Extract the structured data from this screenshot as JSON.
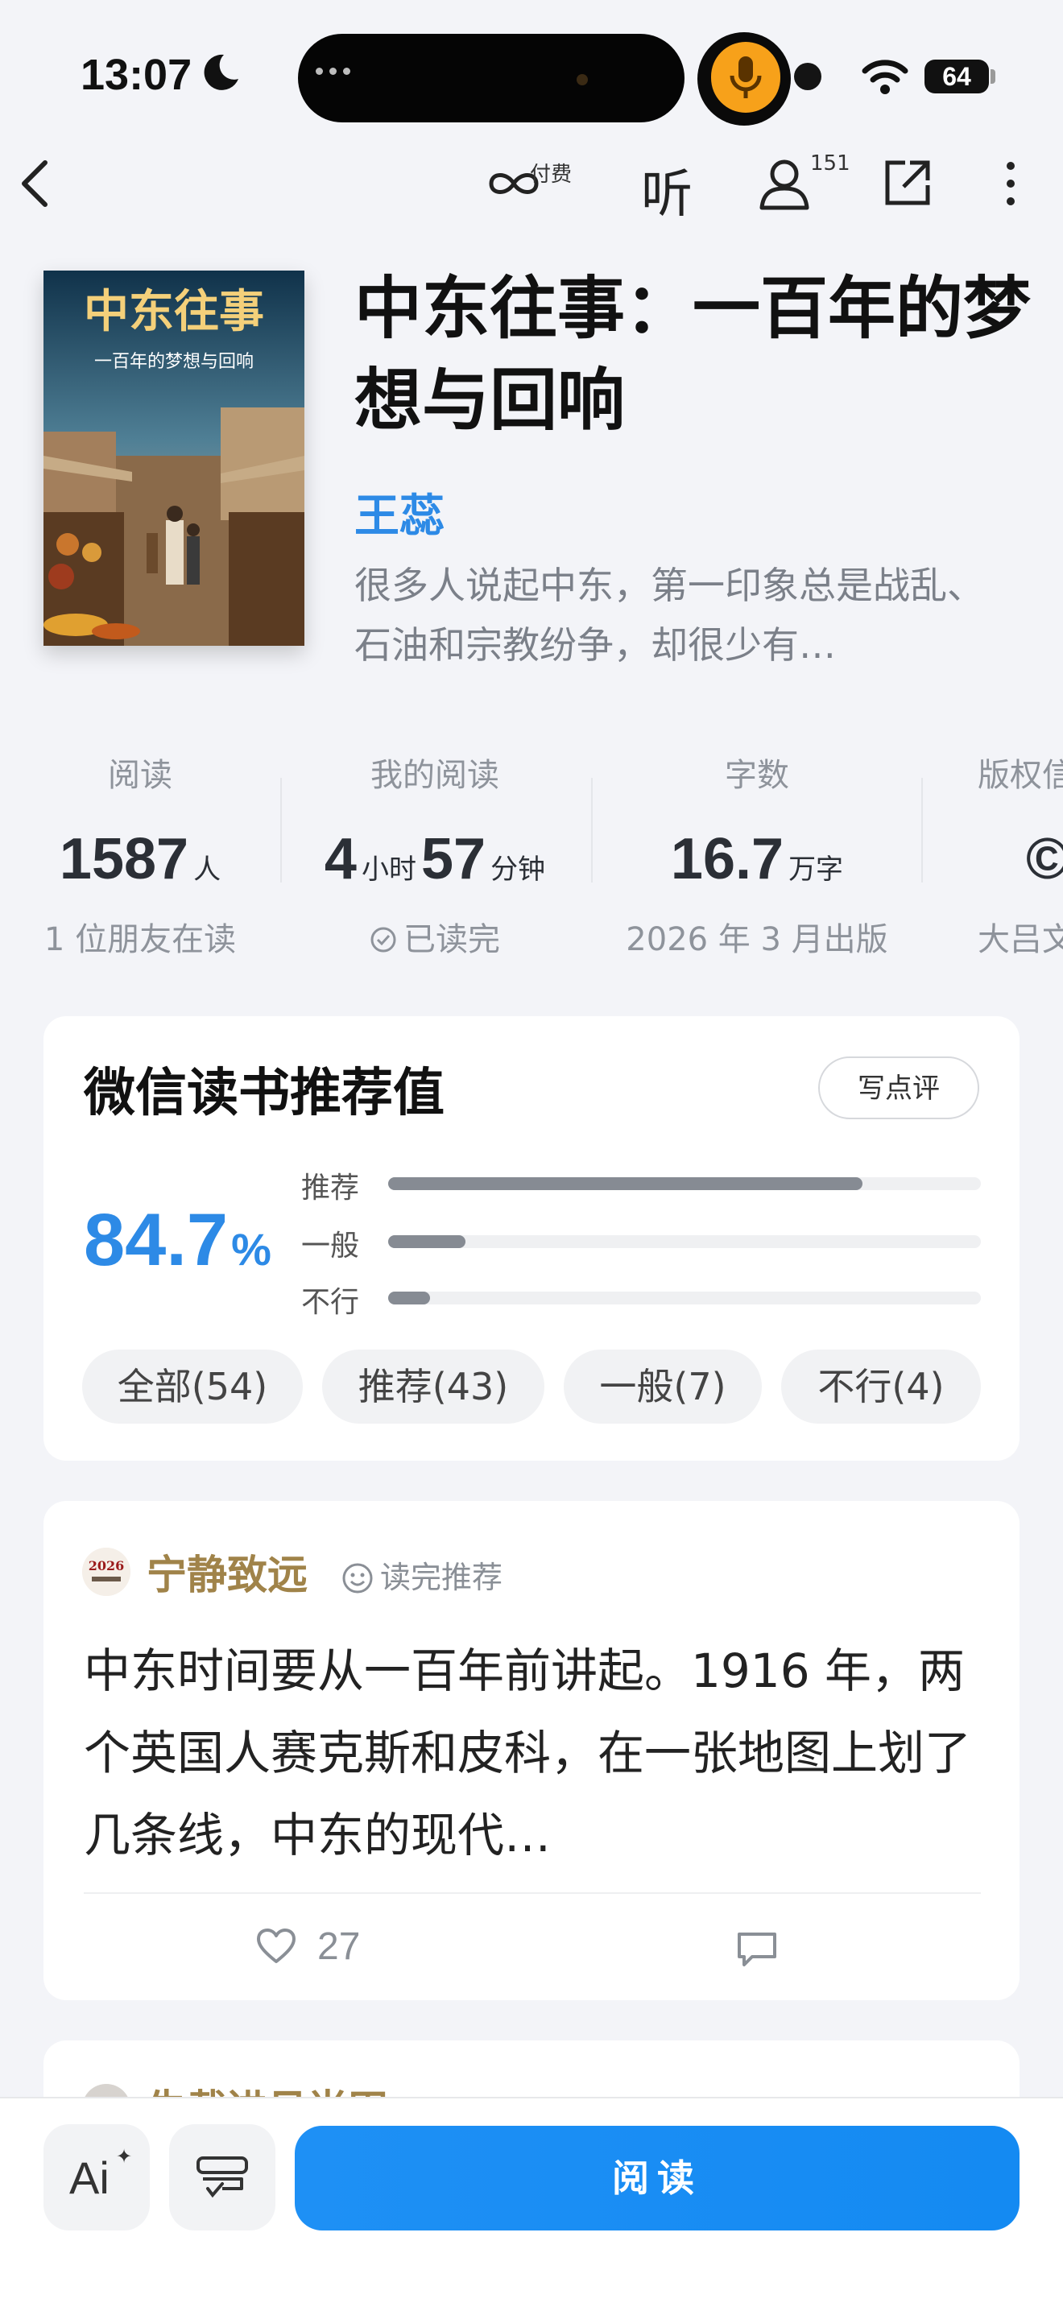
{
  "status_bar": {
    "time": "13:07",
    "battery": "64"
  },
  "nav": {
    "paid_label": "付费",
    "listen_label": "听",
    "readers_count": "151"
  },
  "book": {
    "cover_title": "中东往事",
    "cover_subtitle": "一百年的梦想与回响",
    "title": "中东往事：一百年的梦想与回响",
    "author": "王蕊",
    "description": "很多人说起中东，第一印象总是战乱、石油和宗教纷争，却很少有…"
  },
  "stats": [
    {
      "label": "阅读",
      "value": "1587",
      "unit": "人",
      "sub": "1 位朋友在读"
    },
    {
      "label": "我的阅读",
      "value_hours": "4",
      "unit_hours": "小时",
      "value_minutes": "57",
      "unit_minutes": "分钟",
      "sub": "已读完"
    },
    {
      "label": "字数",
      "value": "16.7",
      "unit": "万字",
      "sub": "2026 年 3 月出版"
    },
    {
      "label": "版权信",
      "value": "©",
      "sub": "大吕文"
    }
  ],
  "recommend": {
    "title": "微信读书推荐值",
    "write_button": "写点评",
    "percent": "84.7",
    "percent_sign": "%",
    "bars": [
      {
        "label": "推荐",
        "fraction": 0.8
      },
      {
        "label": "一般",
        "fraction": 0.13
      },
      {
        "label": "不行",
        "fraction": 0.07
      }
    ],
    "filters": [
      "全部(54)",
      "推荐(43)",
      "一般(7)",
      "不行(4)"
    ]
  },
  "review": {
    "avatar_text": "2026",
    "reviewer": "宁静致远",
    "tag": "读完推荐",
    "text": "中东时间要从一百年前讲起。1916 年，两个英国人赛克斯和皮科，在一张地图上划了几条线，中东的现代…",
    "likes": "27"
  },
  "next_review": {
    "reviewer": "失载进见尚田"
  },
  "bottom": {
    "ai_label": "Ai",
    "read_label": "阅读"
  },
  "colors": {
    "accent": "#2d8ae6",
    "reviewer": "#a08349",
    "read_button": "#1e90f5"
  }
}
